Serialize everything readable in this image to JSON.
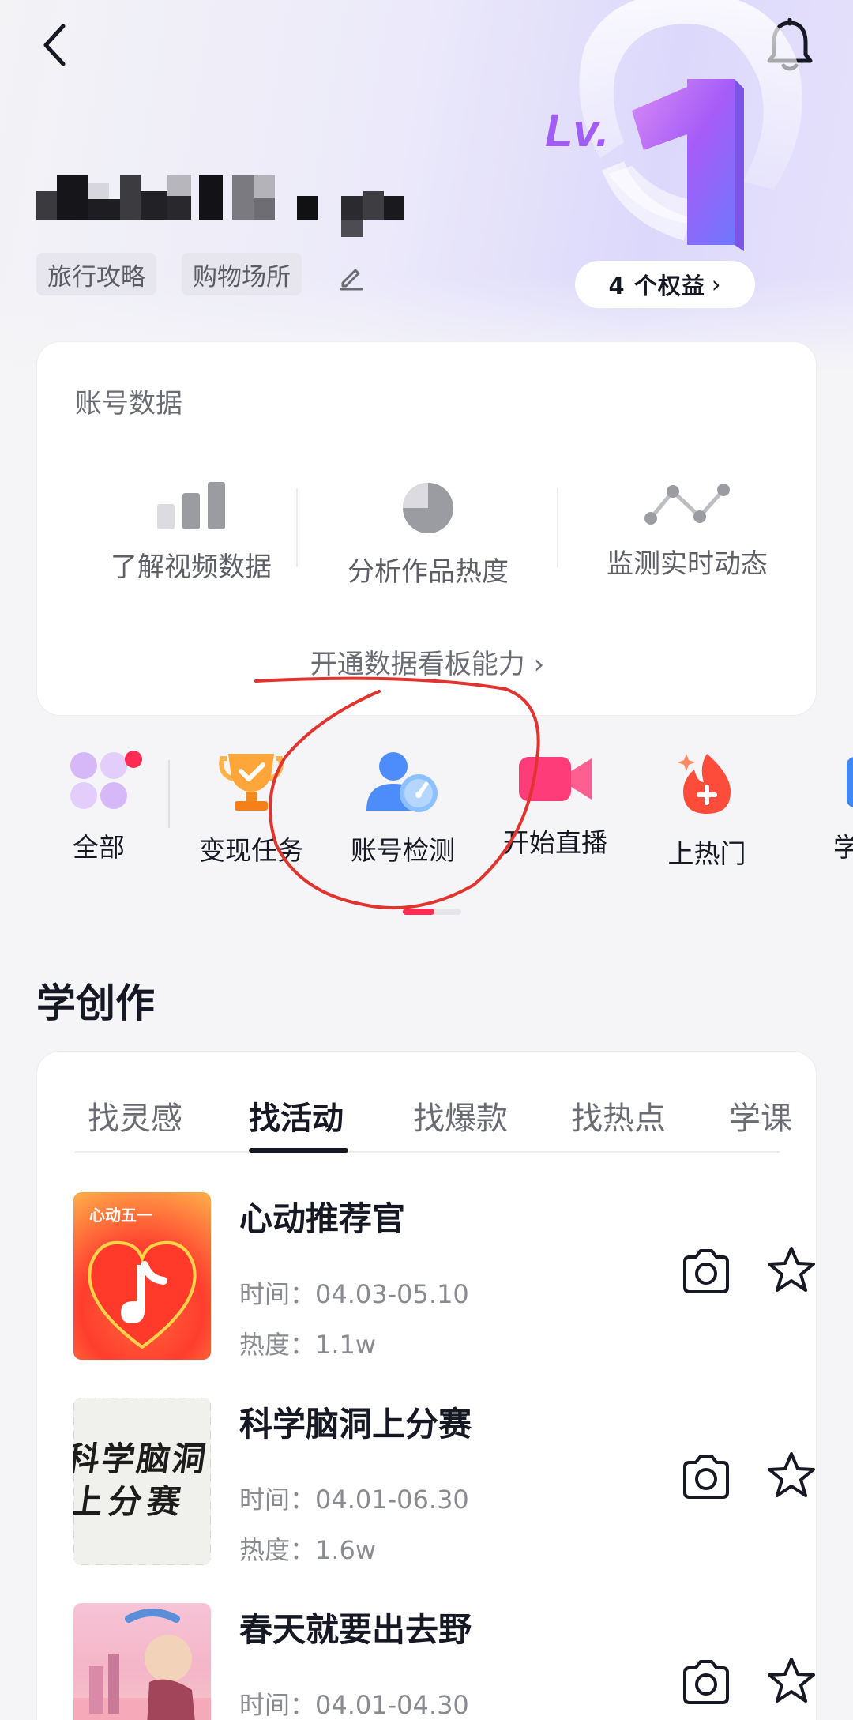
{
  "header": {
    "benefits_label": "4 个权益",
    "benefits_chevron": "›",
    "level_text": "Lv.",
    "level_number": "1"
  },
  "profile": {
    "tags": [
      "旅行攻略",
      "购物场所"
    ]
  },
  "data_card": {
    "title": "账号数据",
    "stats": [
      {
        "label": "了解视频数据",
        "icon": "bar-chart-icon"
      },
      {
        "label": "分析作品热度",
        "icon": "pie-chart-icon"
      },
      {
        "label": "监测实时动态",
        "icon": "line-trend-icon"
      }
    ],
    "open_board_label": "开通数据看板能力",
    "open_board_chevron": "›"
  },
  "shortcuts": [
    {
      "label": "全部",
      "icon": "grid-icon"
    },
    {
      "label": "变现任务",
      "icon": "trophy-icon"
    },
    {
      "label": "账号检测",
      "icon": "account-check-icon"
    },
    {
      "label": "开始直播",
      "icon": "video-camera-icon"
    },
    {
      "label": "上热门",
      "icon": "flame-plus-icon"
    },
    {
      "label": "学习",
      "icon": "book-icon"
    }
  ],
  "learn": {
    "section_title": "学创作",
    "tabs": [
      "找灵感",
      "找活动",
      "找爆款",
      "找热点",
      "学课"
    ],
    "active_tab": 1,
    "time_label": "时间：",
    "heat_label": "热度：",
    "items": [
      {
        "title": "心动推荐官",
        "time": "04.03-05.10",
        "heat": "1.1w",
        "thumb_text": "心动五一"
      },
      {
        "title": "科学脑洞上分赛",
        "time": "04.01-06.30",
        "heat": "1.6w",
        "thumb_text": "科学脑洞上分赛"
      },
      {
        "title": "春天就要出去野",
        "time": "04.01-04.30",
        "heat": ""
      }
    ]
  },
  "colors": {
    "accent": "#fe2c55",
    "annotation": "#e2342f",
    "level_purple": "#9b5cf6"
  }
}
